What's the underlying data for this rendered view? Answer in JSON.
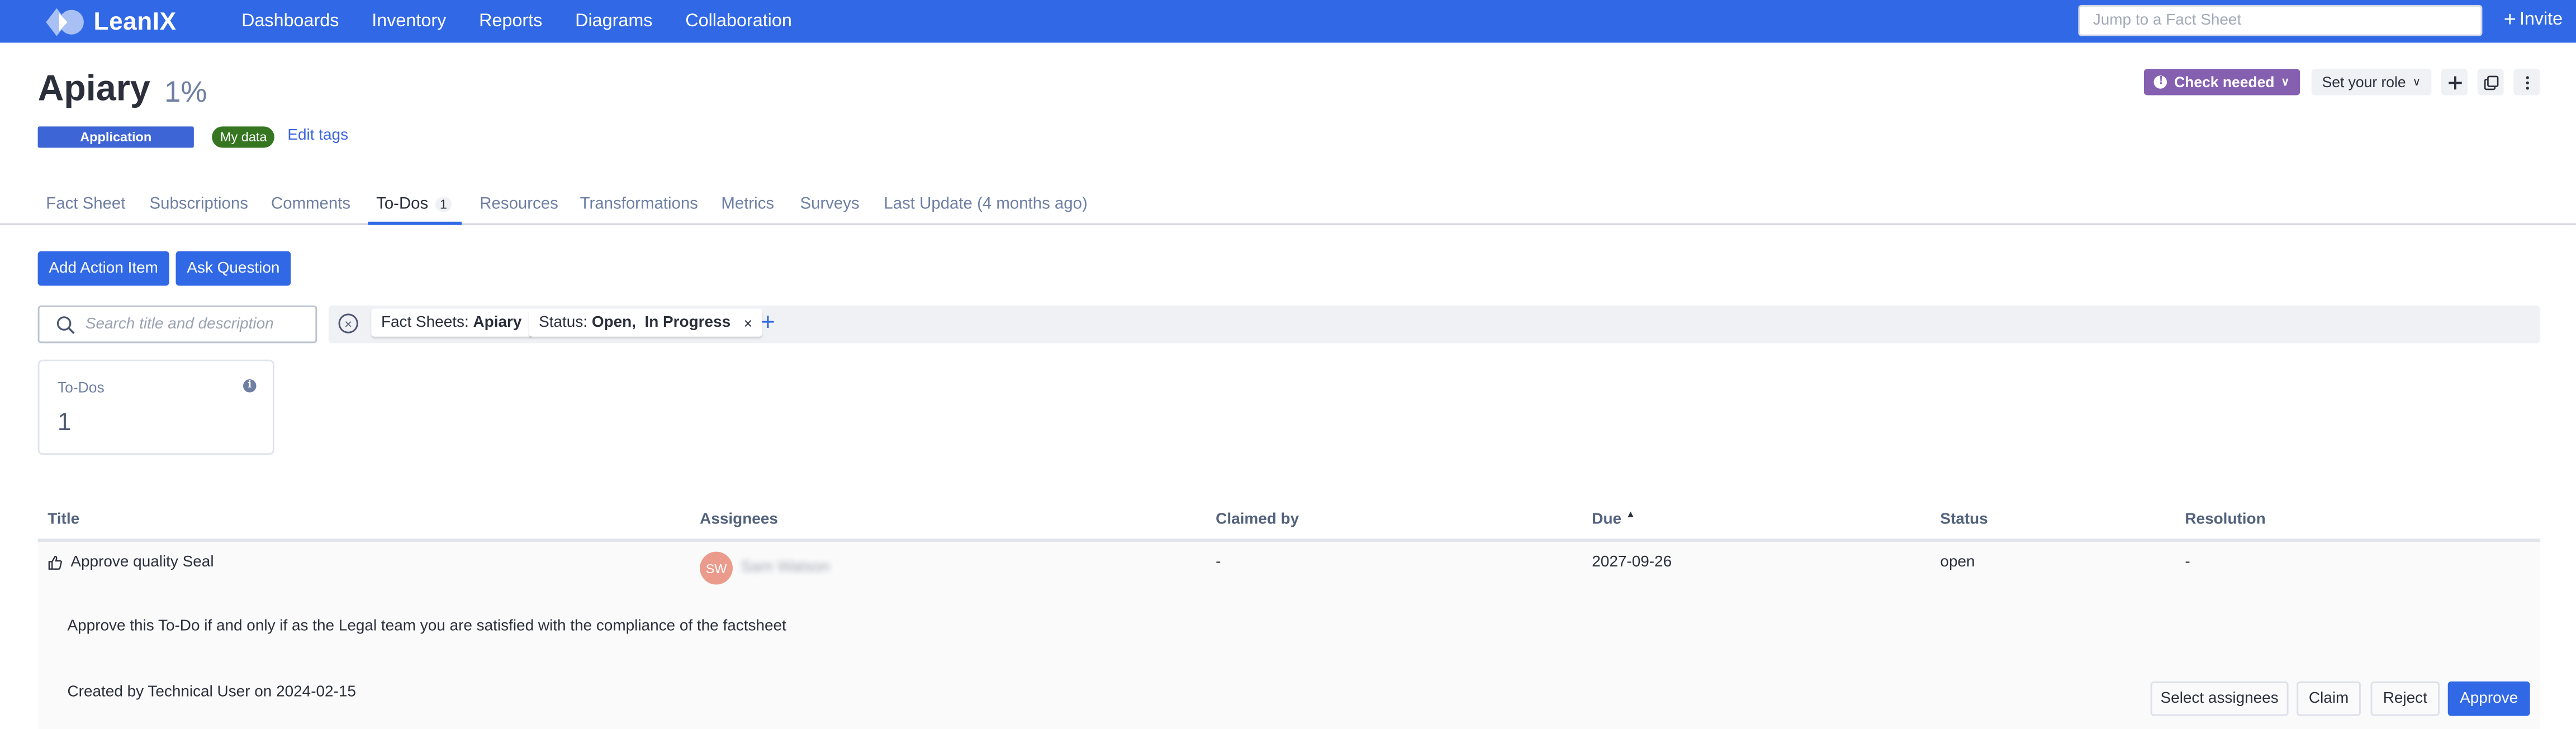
{
  "topnav": {
    "brand": "LeanIX",
    "items": [
      {
        "label": "Dashboards"
      },
      {
        "label": "Inventory"
      },
      {
        "label": "Reports"
      },
      {
        "label": "Diagrams"
      },
      {
        "label": "Collaboration"
      }
    ],
    "search_placeholder": "Jump to a Fact Sheet",
    "invite_label": "Invite",
    "color": "#3068e6"
  },
  "header": {
    "title": "Apiary",
    "completion": "1%",
    "type_badge": "Application",
    "tag": "My data",
    "edit_tags": "Edit tags",
    "check_needed": "Check needed",
    "role_select": "Set your role",
    "icons": [
      "plus-icon",
      "copy-icon",
      "more-vertical-icon"
    ]
  },
  "tabs": [
    {
      "label": "Fact Sheet",
      "active": false
    },
    {
      "label": "Subscriptions",
      "active": false
    },
    {
      "label": "Comments",
      "active": false
    },
    {
      "label": "To-Dos",
      "count": "1",
      "active": true
    },
    {
      "label": "Resources",
      "active": false
    },
    {
      "label": "Transformations",
      "active": false
    },
    {
      "label": "Metrics",
      "active": false
    },
    {
      "label": "Surveys",
      "active": false
    },
    {
      "label": "Last Update (4 months ago)",
      "active": false
    }
  ],
  "actions": {
    "add_action_item": "Add Action Item",
    "ask_question": "Ask Question"
  },
  "search": {
    "placeholder": "Search title and description",
    "value": ""
  },
  "filters": [
    {
      "key": "Fact Sheets:",
      "value": "Apiary",
      "removable": false
    },
    {
      "key": "Status:",
      "value": "Open,  In Progress",
      "removable": true
    }
  ],
  "metric_card": {
    "label": "To-Dos",
    "value": "1"
  },
  "table": {
    "columns": [
      "Title",
      "Assignees",
      "Claimed by",
      "Due",
      "Status",
      "Resolution"
    ],
    "sort": {
      "column": "Due",
      "direction": "ascending"
    },
    "rows": [
      {
        "title": "Approve quality Seal",
        "assignee_initials": "SW",
        "assignee_name": "Sam Watson",
        "claimed_by": "-",
        "due": "2027-09-26",
        "status": "open",
        "resolution": "-",
        "description": "Approve this To-Do if and only if as the Legal team you are satisfied with the compliance of the factsheet",
        "created": "Created by Technical User on 2024-02-15",
        "buttons": {
          "select_assignees": "Select assignees",
          "claim": "Claim",
          "reject": "Reject",
          "approve": "Approve"
        }
      }
    ]
  }
}
